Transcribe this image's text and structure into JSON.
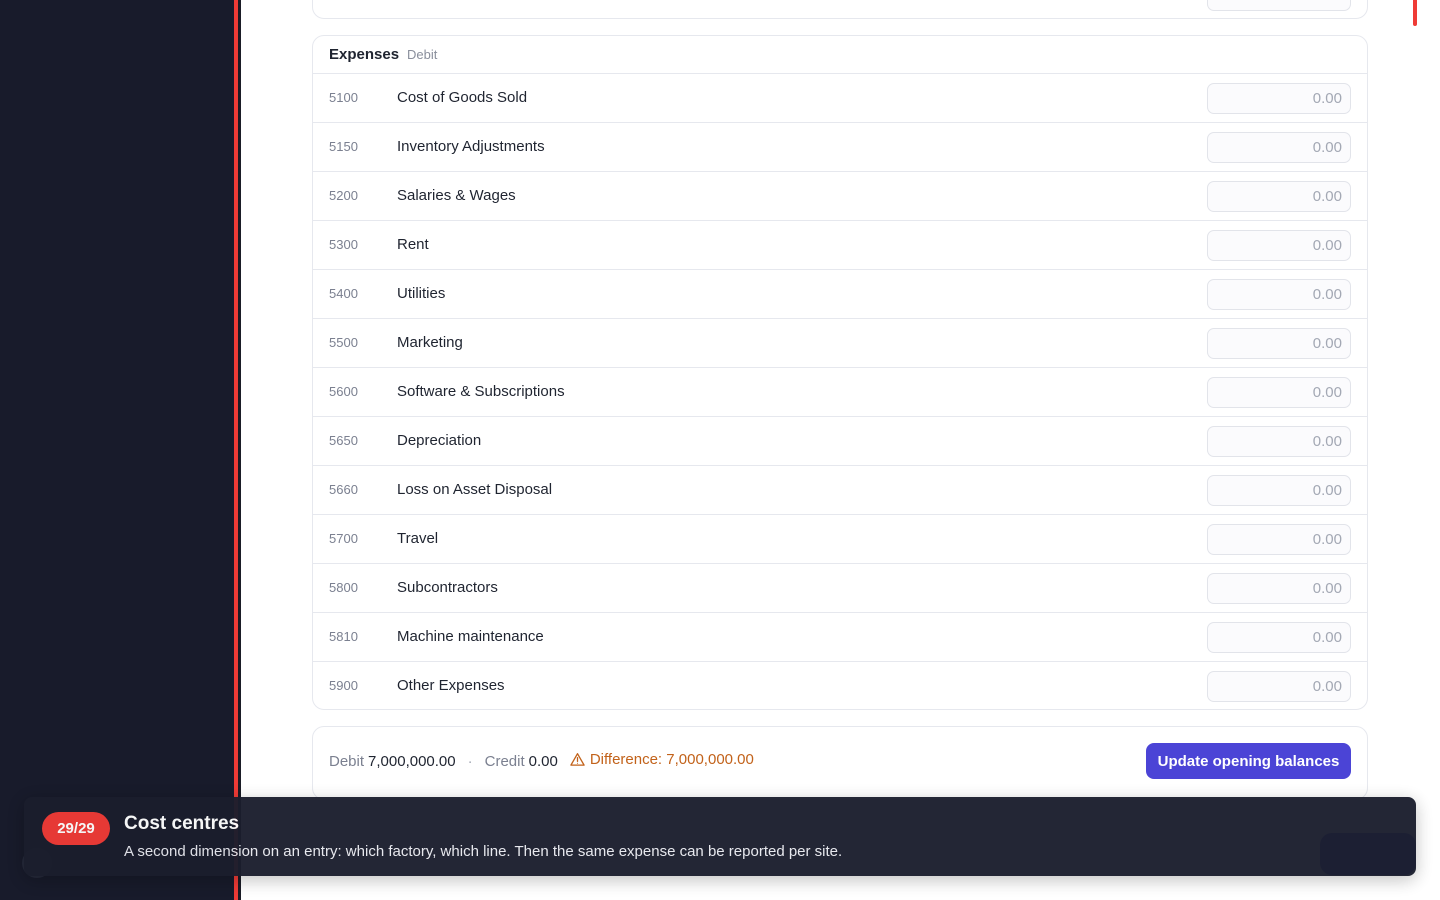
{
  "colors": {
    "sidebar_bg": "#181b2b",
    "accent_red": "#ef3b36",
    "primary_button": "#4b44d6",
    "warning": "#c2621a",
    "toast_bg": "#1b1e2d"
  },
  "expenses": {
    "title": "Expenses",
    "subtitle": "Debit",
    "accounts": [
      {
        "code": "5100",
        "name": "Cost of Goods Sold",
        "placeholder": "0.00"
      },
      {
        "code": "5150",
        "name": "Inventory Adjustments",
        "placeholder": "0.00"
      },
      {
        "code": "5200",
        "name": "Salaries & Wages",
        "placeholder": "0.00"
      },
      {
        "code": "5300",
        "name": "Rent",
        "placeholder": "0.00"
      },
      {
        "code": "5400",
        "name": "Utilities",
        "placeholder": "0.00"
      },
      {
        "code": "5500",
        "name": "Marketing",
        "placeholder": "0.00"
      },
      {
        "code": "5600",
        "name": "Software & Subscriptions",
        "placeholder": "0.00"
      },
      {
        "code": "5650",
        "name": "Depreciation",
        "placeholder": "0.00"
      },
      {
        "code": "5660",
        "name": "Loss on Asset Disposal",
        "placeholder": "0.00"
      },
      {
        "code": "5700",
        "name": "Travel",
        "placeholder": "0.00"
      },
      {
        "code": "5800",
        "name": "Subcontractors",
        "placeholder": "0.00"
      },
      {
        "code": "5810",
        "name": "Machine maintenance",
        "placeholder": "0.00"
      },
      {
        "code": "5900",
        "name": "Other Expenses",
        "placeholder": "0.00"
      }
    ]
  },
  "summary": {
    "debit_label": "Debit",
    "debit_value": "7,000,000.00",
    "separator": "·",
    "credit_label": "Credit",
    "credit_value": "0.00",
    "difference_text": "Difference: 7,000,000.00",
    "difference_icon": "warning-triangle-icon",
    "update_button_label": "Update opening balances"
  },
  "tour": {
    "step_badge": "29/29",
    "title": "Cost centres",
    "body": "A second dimension on an entry: which factory, which line. Then the same expense can be reported per site."
  }
}
